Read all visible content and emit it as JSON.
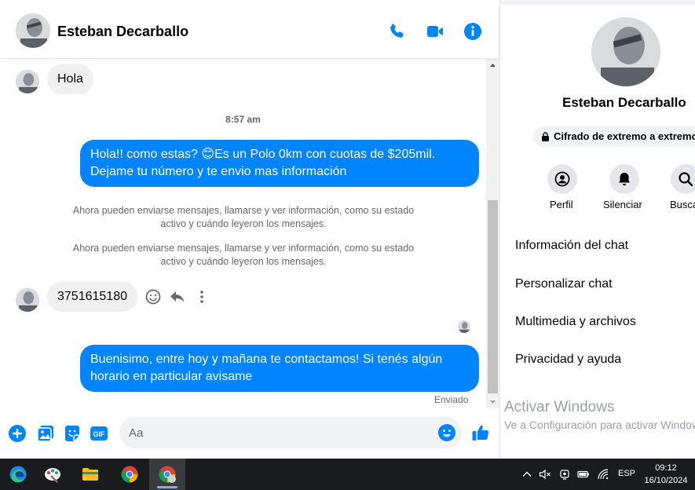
{
  "header": {
    "contact_name": "Esteban Decarballo"
  },
  "messages": {
    "m1_text": "Hola",
    "time_1": "8:57 am",
    "m2_line1": "Hola!! como estas? 😊Es un Polo 0km con cuotas de $205mil.",
    "m2_line2": "Dejame tu número y te envio mas información",
    "sys1_line1": "Ahora pueden enviarse mensajes, llamarse y ver información, como su estado",
    "sys1_line2": "activo y cuándo leyeron los mensajes.",
    "sys2_line1": "Ahora pueden enviarse mensajes, llamarse y ver información, como su estado",
    "sys2_line2": "activo y cuándo leyeron los mensajes.",
    "m3_text": "3751615180",
    "m4_line1": "Buenisimo, entre hoy y mañana te contactamos! Si tenés algún",
    "m4_line2": "horario en particular avisame",
    "sent_status": "Enviado"
  },
  "composer": {
    "placeholder": "Aa"
  },
  "profile": {
    "name": "Esteban Decarballo",
    "encryption": "Cifrado de extremo a extremo",
    "actions": [
      {
        "label": "Perfil"
      },
      {
        "label": "Silenciar"
      },
      {
        "label": "Buscar"
      }
    ],
    "menu": [
      {
        "label": "Información del chat"
      },
      {
        "label": "Personalizar chat"
      },
      {
        "label": "Multimedia y archivos"
      },
      {
        "label": "Privacidad y ayuda"
      }
    ],
    "activate_title": "Activar Windows",
    "activate_sub": "Ve a Configuración para activar Windows."
  },
  "taskbar": {
    "language": "ESP",
    "time": "09:12",
    "date": "16/10/2024"
  },
  "colors": {
    "accent": "#0084ff",
    "bubble_in": "#f0f0f0",
    "taskbar": "#1a1b1e"
  }
}
